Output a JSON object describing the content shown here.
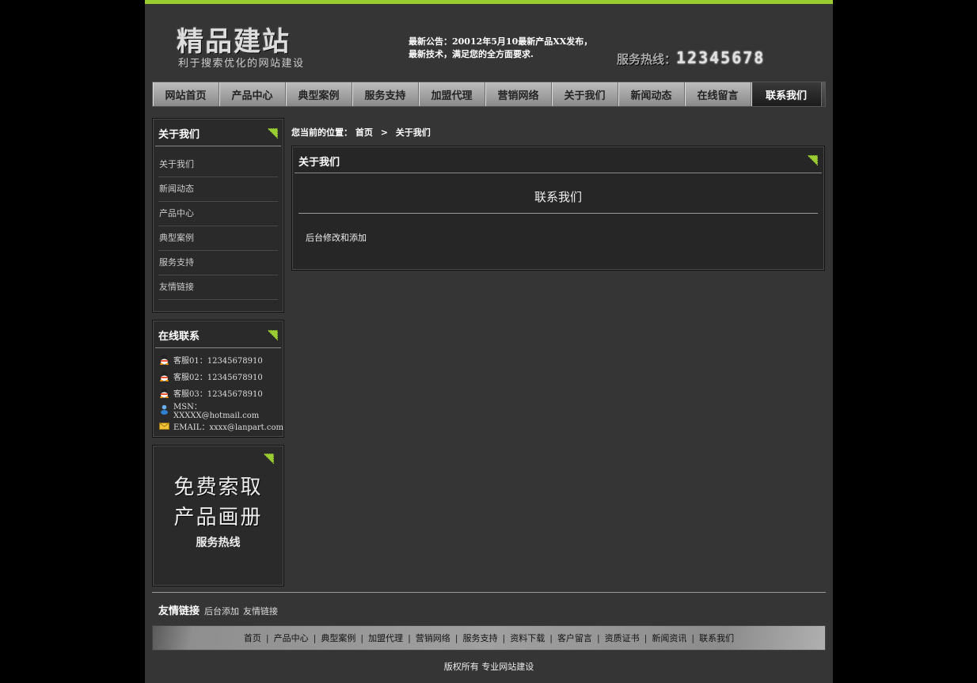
{
  "header": {
    "logo_title": "精品建站",
    "logo_sub": "利于搜索优化的网站建设",
    "notice_line1": "最新公告：20012年5月10最新产品XX发布，",
    "notice_line2": "最新技术，满足您的全方面要求.",
    "hotline_label": "服务热线：",
    "hotline_number": "12345678"
  },
  "nav": {
    "items": [
      "网站首页",
      "产品中心",
      "典型案例",
      "服务支持",
      "加盟代理",
      "营销网络",
      "关于我们",
      "新闻动态",
      "在线留言",
      "联系我们"
    ],
    "active_index": 9
  },
  "sidebar": {
    "about": {
      "title": "关于我们",
      "items": [
        "关于我们",
        "新闻动态",
        "产品中心",
        "典型案例",
        "服务支持",
        "友情链接"
      ]
    },
    "online": {
      "title": "在线联系",
      "items": [
        {
          "icon": "qq-icon",
          "text": "客服01：12345678910"
        },
        {
          "icon": "qq-icon",
          "text": "客服02：12345678910"
        },
        {
          "icon": "qq-icon",
          "text": "客服03：12345678910"
        },
        {
          "icon": "msn-icon",
          "text": "MSN：XXXXX@hotmail.com"
        },
        {
          "icon": "email-icon",
          "text": "EMAIL：xxxx@lanpart.com"
        }
      ]
    },
    "promo": {
      "line1": "免费索取",
      "line2": "产品画册",
      "line3": "服务热线"
    }
  },
  "breadcrumb": {
    "prefix": "您当前的位置：",
    "home": "首页",
    "separator": ">",
    "current": "关于我们"
  },
  "main": {
    "box_title": "关于我们",
    "article_title": "联系我们",
    "article_body": "后台修改和添加"
  },
  "footer": {
    "friend_title": "友情链接",
    "friend_items": [
      "后台添加",
      "友情链接"
    ],
    "nav_items": [
      "首页",
      "产品中心",
      "典型案例",
      "加盟代理",
      "营销网络",
      "服务支持",
      "资料下载",
      "客户留言",
      "资质证书",
      "新闻资讯",
      "联系我们"
    ],
    "copyright": "版权所有 专业网站建设"
  },
  "colors": {
    "accent": "#9acd32",
    "page_bg": "#353535",
    "outer_bg": "#000000"
  }
}
